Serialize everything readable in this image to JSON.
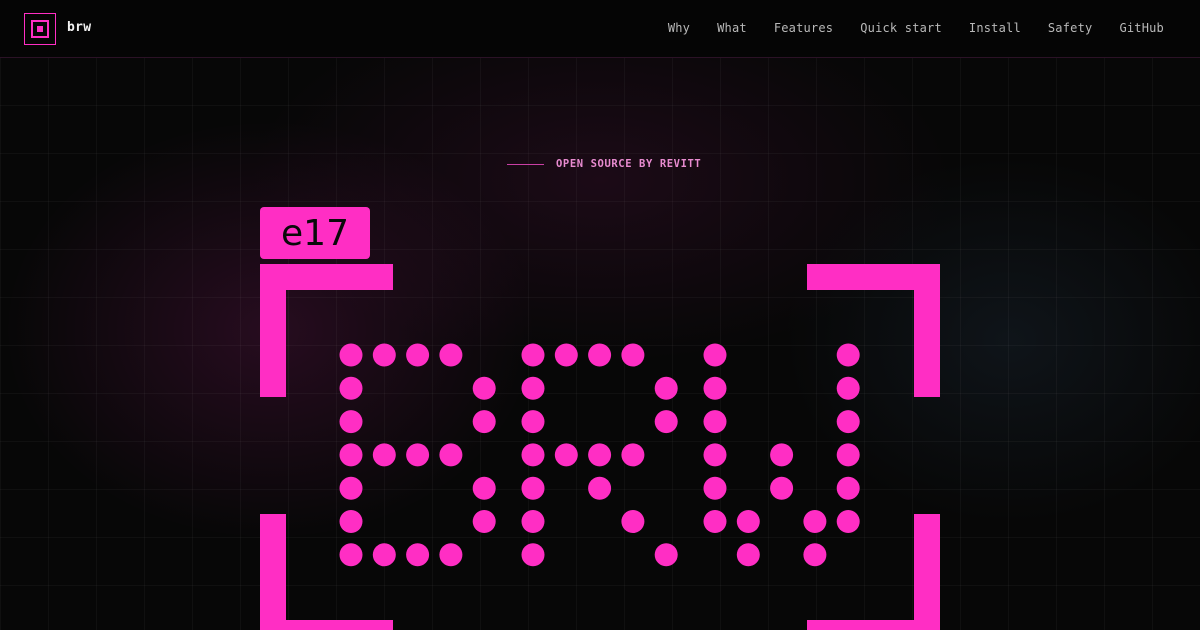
{
  "header": {
    "brand": "brw",
    "nav": [
      "Why",
      "What",
      "Features",
      "Quick start",
      "Install",
      "Safety",
      "GitHub"
    ]
  },
  "hero": {
    "eyebrow": "OPEN SOURCE BY REVITT",
    "badge": "e17",
    "matrix_text": "BRW"
  },
  "icons": {
    "logo": "square-target-icon"
  },
  "colors": {
    "accent": "#ff2ec4",
    "background": "#070707",
    "nav_text": "#b9b9b9",
    "eyebrow_text": "#e88bd0"
  }
}
